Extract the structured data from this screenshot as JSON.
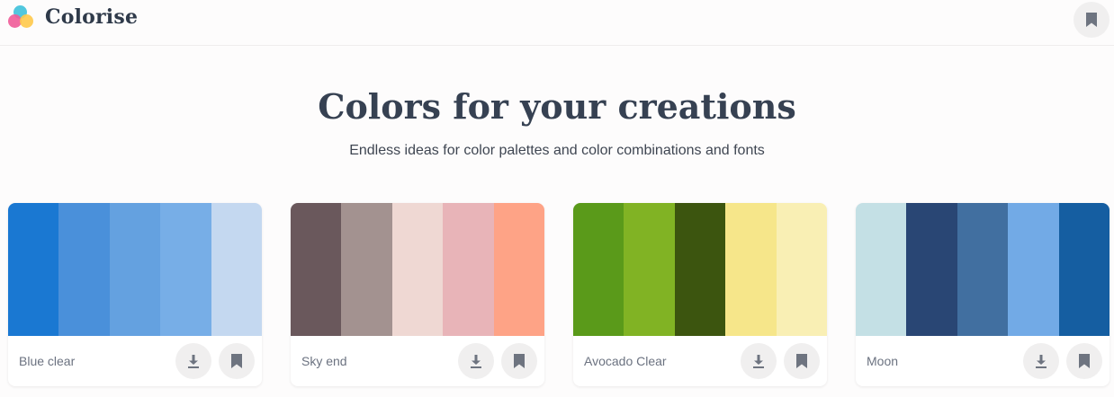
{
  "app": {
    "name": "Colorise",
    "logo_colors": [
      "#3ec1da",
      "#ef5b98",
      "#ffc94a"
    ]
  },
  "icons": {
    "bookmark": "bookmark-icon",
    "download": "download-icon"
  },
  "hero": {
    "title": "Colors for your creations",
    "subtitle": "Endless ideas for color palettes and color combinations and fonts"
  },
  "palettes": [
    {
      "name": "Blue clear",
      "colors": [
        "#1a78d2",
        "#4a90da",
        "#64a1e0",
        "#77aee7",
        "#c4d8f0"
      ]
    },
    {
      "name": "Sky end",
      "colors": [
        "#6a585c",
        "#a39290",
        "#efd8d3",
        "#e8b4b8",
        "#fea386"
      ]
    },
    {
      "name": "Avocado Clear",
      "colors": [
        "#5a9a1a",
        "#81b324",
        "#3c550f",
        "#f6e68a",
        "#f9efb4"
      ]
    },
    {
      "name": "Moon",
      "colors": [
        "#c4e0e5",
        "#294674",
        "#416fa0",
        "#72aae6",
        "#155ea1"
      ]
    }
  ]
}
